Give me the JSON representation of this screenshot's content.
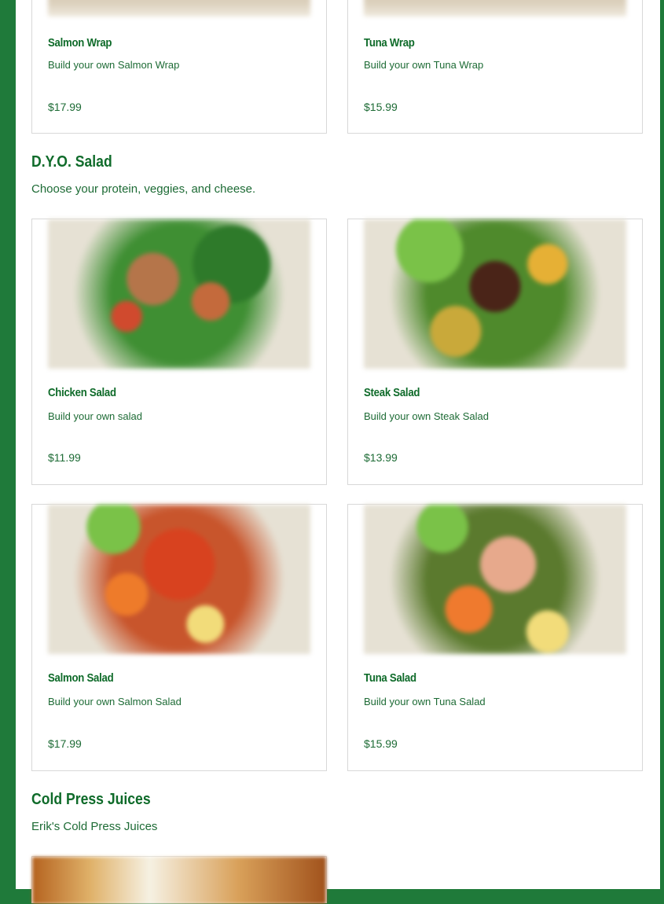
{
  "wraps": [
    {
      "name": "Salmon Wrap",
      "desc": "Build your own Salmon Wrap",
      "price": "$17.99"
    },
    {
      "name": "Tuna Wrap",
      "desc": "Build your own Tuna Wrap",
      "price": "$15.99"
    }
  ],
  "salad_section": {
    "title": "D.Y.O. Salad",
    "description": "Choose your protein, veggies, and cheese."
  },
  "salads": [
    {
      "name": "Chicken Salad",
      "desc": "Build your own salad",
      "price": "$11.99"
    },
    {
      "name": "Steak Salad",
      "desc": "Build your own Steak Salad",
      "price": "$13.99"
    },
    {
      "name": "Salmon Salad",
      "desc": "Build your own Salmon Salad",
      "price": "$17.99"
    },
    {
      "name": "Tuna Salad",
      "desc": "Build your own Tuna Salad",
      "price": "$15.99"
    }
  ],
  "juice_section": {
    "title": "Cold Press Juices",
    "description": "Erik's Cold Press Juices"
  },
  "colors": {
    "brand_green": "#0f6b2a",
    "side_background": "#1f7a3a"
  }
}
